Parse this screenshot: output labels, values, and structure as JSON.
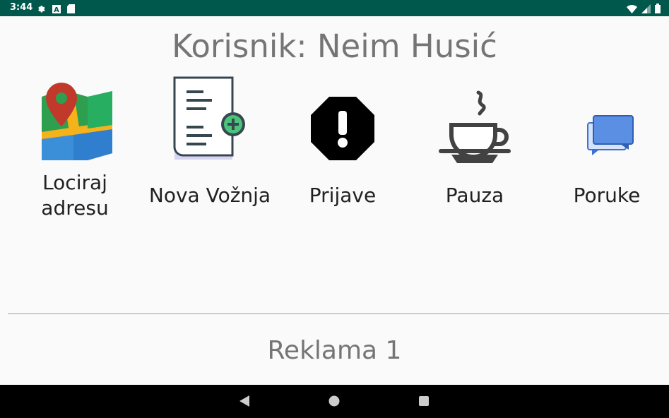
{
  "status_bar": {
    "time": "3:44",
    "left_icons": [
      "gear-icon",
      "a-icon",
      "sd-card-icon"
    ],
    "right_icons": [
      "wifi-icon",
      "signal-icon",
      "battery-icon"
    ]
  },
  "header": {
    "title": "Korisnik: Neim Husić"
  },
  "menu": {
    "items": [
      {
        "label": "Lociraj\nadresu",
        "icon": "map-pin-icon"
      },
      {
        "label": "Nova Vožnja",
        "icon": "new-document-icon"
      },
      {
        "label": "Prijave",
        "icon": "alert-octagon-icon"
      },
      {
        "label": "Pauza",
        "icon": "coffee-cup-icon"
      },
      {
        "label": "Poruke",
        "icon": "chat-icon"
      }
    ]
  },
  "ad": {
    "text": "Reklama 1"
  },
  "nav_bar": {
    "buttons": [
      "back-icon",
      "home-icon",
      "recents-icon"
    ]
  },
  "colors": {
    "status_bar": "#00574b",
    "title_text": "#757575",
    "label_text": "#212121",
    "nav_bar": "#000000"
  }
}
